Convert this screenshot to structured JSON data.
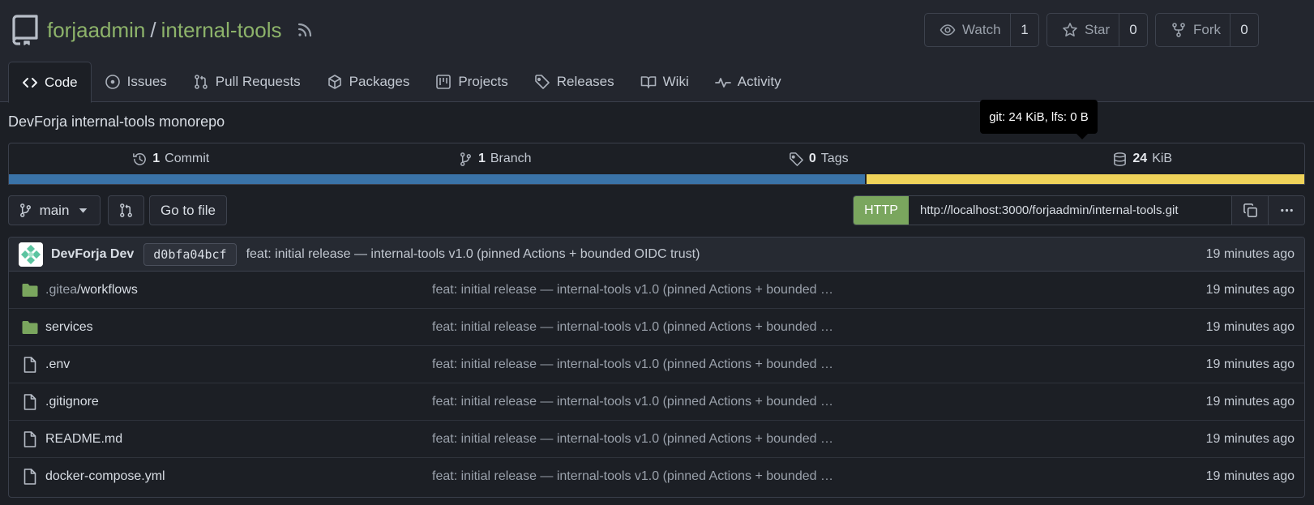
{
  "repo": {
    "owner": "forjaadmin",
    "separator": "/",
    "name": "internal-tools",
    "description": "DevForja internal-tools monorepo"
  },
  "actions": {
    "watch": {
      "label": "Watch",
      "count": "1"
    },
    "star": {
      "label": "Star",
      "count": "0"
    },
    "fork": {
      "label": "Fork",
      "count": "0"
    }
  },
  "tabs": [
    {
      "label": "Code",
      "icon": "code-icon"
    },
    {
      "label": "Issues",
      "icon": "issue-icon"
    },
    {
      "label": "Pull Requests",
      "icon": "pull-request-icon"
    },
    {
      "label": "Packages",
      "icon": "package-icon"
    },
    {
      "label": "Projects",
      "icon": "project-icon"
    },
    {
      "label": "Releases",
      "icon": "tag-icon"
    },
    {
      "label": "Wiki",
      "icon": "book-icon"
    },
    {
      "label": "Activity",
      "icon": "pulse-icon"
    }
  ],
  "stats": {
    "commits": {
      "count": "1",
      "label": "Commit"
    },
    "branches": {
      "count": "1",
      "label": "Branch"
    },
    "tags": {
      "count": "0",
      "label": "Tags"
    },
    "size": {
      "count": "24",
      "label": "KiB"
    }
  },
  "tooltip": "git: 24 KiB, lfs: 0 B",
  "language_bar": {
    "blue_fraction": 0.661,
    "colors": {
      "blue": "#3a73a8",
      "yellow": "#efd35a"
    }
  },
  "toolbar": {
    "branch": "main",
    "go_to_file": "Go to file",
    "clone_protocol": "HTTP",
    "clone_url": "http://localhost:3000/forjaadmin/internal-tools.git"
  },
  "latest_commit": {
    "author": "DevForja Dev",
    "sha": "d0bfa04bcf",
    "message": "feat: initial release — internal-tools v1.0 (pinned Actions + bounded OIDC trust)",
    "time": "19 minutes ago"
  },
  "files": [
    {
      "type": "folder",
      "name_dim": ".gitea",
      "name": "/workflows",
      "message": "feat: initial release — internal-tools v1.0 (pinned Actions + bounded OIDC trust)",
      "time": "19 minutes ago"
    },
    {
      "type": "folder",
      "name_dim": "",
      "name": "services",
      "message": "feat: initial release — internal-tools v1.0 (pinned Actions + bounded OIDC trust)",
      "time": "19 minutes ago"
    },
    {
      "type": "file",
      "name_dim": "",
      "name": ".env",
      "message": "feat: initial release — internal-tools v1.0 (pinned Actions + bounded OIDC trust)",
      "time": "19 minutes ago"
    },
    {
      "type": "file",
      "name_dim": "",
      "name": ".gitignore",
      "message": "feat: initial release — internal-tools v1.0 (pinned Actions + bounded OIDC trust)",
      "time": "19 minutes ago"
    },
    {
      "type": "file",
      "name_dim": "",
      "name": "README.md",
      "message": "feat: initial release — internal-tools v1.0 (pinned Actions + bounded OIDC trust)",
      "time": "19 minutes ago"
    },
    {
      "type": "file",
      "name_dim": "",
      "name": "docker-compose.yml",
      "message": "feat: initial release — internal-tools v1.0 (pinned Actions + bounded OIDC trust)",
      "time": "19 minutes ago"
    }
  ],
  "colors": {
    "link_green": "#8db36a",
    "folder_green": "#7aa65e",
    "background": "#1c1f25"
  }
}
